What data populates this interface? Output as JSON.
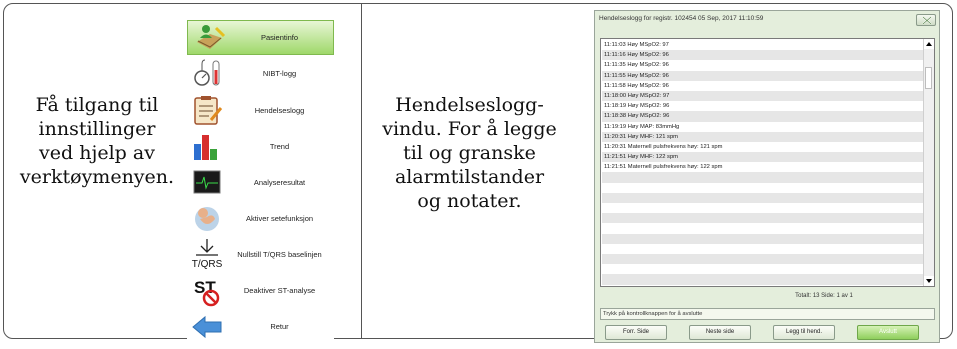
{
  "captions": {
    "left": "Få tilgang til\ninnstillinger\nved hjelp av\nverktøymenyen.",
    "right": "Hendelseslogg-\nvindu. For å legge\ntil og granske\nalarmtilstander\nog notater."
  },
  "menu": {
    "items": [
      {
        "label": "Pasientinfo",
        "icon": "patient-info-icon",
        "active": true
      },
      {
        "label": "NIBT-logg",
        "icon": "blood-pressure-icon"
      },
      {
        "label": "Hendelseslogg",
        "icon": "event-log-icon"
      },
      {
        "label": "Trend",
        "icon": "bar-chart-icon"
      },
      {
        "label": "Analyseresultat",
        "icon": "ecg-monitor-icon"
      },
      {
        "label": "Aktiver setefunksjon",
        "icon": "fetus-icon"
      },
      {
        "label": "Nullstill T/QRS baselinjen",
        "icon": "reset-baseline-icon",
        "icon_text": "T/QRS"
      },
      {
        "label": "Deaktiver ST-analyse",
        "icon": "st-disable-icon",
        "icon_text": "ST"
      },
      {
        "label": "Retur",
        "icon": "back-arrow-icon"
      }
    ]
  },
  "dialog": {
    "title": "Hendelseslogg for registr. 102454  05 Sep, 2017 11:10:59",
    "entries": [
      "11:11:03 Høy MSpO2: 97",
      "11:11:16 Høy MSpO2: 96",
      "11:11:35 Høy MSpO2: 96",
      "11:11:55 Høy MSpO2: 96",
      "11:11:58 Høy MSpO2: 96",
      "11:18:00 Høy MSpO2: 97",
      "11:18:19 Høy MSpO2: 96",
      "11:18:38 Høy MSpO2: 96",
      "11:19:19 Høy MAP: 83mmHg",
      "11:20:31 Høy MHF: 121 spm",
      "11:20:31 Maternell pulsfrekvens høy: 121 spm",
      "11:21:51 Høy MHF: 122 spm",
      "11:21:51 Maternell pulsfrekvens høy: 122 spm"
    ],
    "total_label": "Totalt: 13  Side: 1 av 1",
    "hint": "Trykk på kontrollknappen for å avslutte",
    "buttons": {
      "prev": "Forr. Side",
      "next": "Neste side",
      "add": "Legg til hend.",
      "close": "Avslutt"
    }
  },
  "colors": {
    "active_menu": "#9fd86a",
    "dialog_bg": "#e4eedc",
    "close_button": "#8fcf5c"
  }
}
